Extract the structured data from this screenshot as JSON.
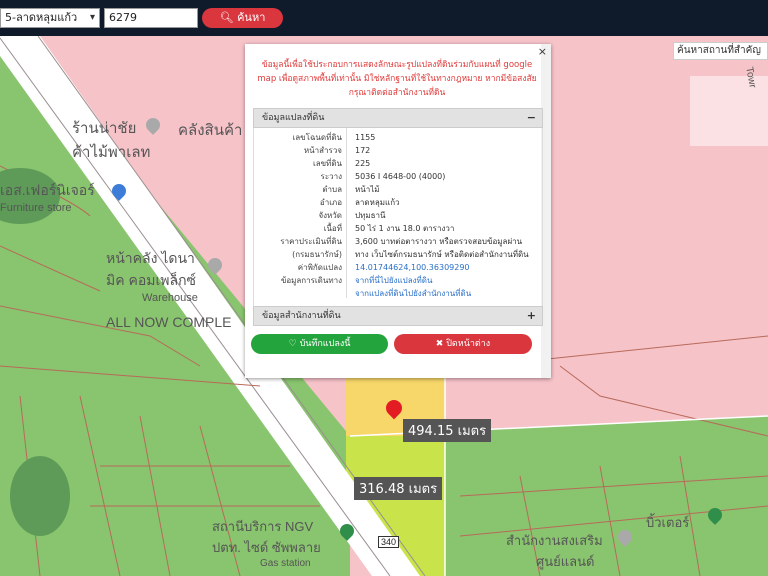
{
  "topbar": {
    "district_select": "5-ลาดหลุมแก้ว",
    "search_value": "6279",
    "search_button": "ค้นหา"
  },
  "map": {
    "search_place_placeholder": "ค้นหาสถานที่สำคัญ",
    "labels": {
      "shop_1_line1": "ร้านน่าชัย",
      "shop_1_line2": "ค้าไม้พาเลท",
      "shop_2": "คลังสินค้า",
      "furniture_line1": "เอส.เฟอร์นิเจอร์",
      "furniture_line2": "Furniture store",
      "warehouse_line1": "หน้าคลัง ไดนา",
      "warehouse_line2": "มิค คอมเพล็กซ์",
      "warehouse_line3": "Warehouse",
      "complex": "ALL NOW COMPLE",
      "gas_line1": "สถานีบริการ NGV",
      "gas_line2": "ปตท. ไซด์ ซัพพลาย",
      "gas_line3": "Gas station",
      "road_right": "Towr",
      "poi_right_1": "บิ้วเตอร์",
      "poi_right_2_line1": "สำนักงานสงเสริม",
      "poi_right_2_line2": "ศูนย์แลนด์",
      "road_number": "340"
    },
    "distance_1": "494.15 เมตร",
    "distance_2": "316.48 เมตร"
  },
  "popup": {
    "close": "×",
    "warning": "ข้อมูลนี้เพื่อใช้ประกอบการแสดงลักษณะรูปแปลงที่ดินร่วมกับแผนที่ google map เพื่อดูสภาพพื้นที่เท่านั้น มิใช่หลักฐานที่ใช้ในทางกฎหมาย หากมีข้อสงสัยกรุณาติดต่อสำนักงานที่ดิน",
    "section_1": "ข้อมูลแปลงที่ดิน",
    "section_1_toggle": "−",
    "rows": [
      {
        "k": "เลขโฉนดที่ดิน",
        "v": "1155"
      },
      {
        "k": "หน้าสำรวจ",
        "v": "172"
      },
      {
        "k": "เลขที่ดิน",
        "v": "225"
      },
      {
        "k": "ระวาง",
        "v": "5036 I 4648-00 (4000)"
      },
      {
        "k": "ตำบล",
        "v": "หน้าไม้"
      },
      {
        "k": "อำเภอ",
        "v": "ลาดหลุมแก้ว"
      },
      {
        "k": "จังหวัด",
        "v": "ปทุมธานี"
      },
      {
        "k": "เนื้อที่",
        "v": "50 ไร่ 1 งาน 18.0 ตารางวา"
      },
      {
        "k": "ราคาประเมินที่ดิน",
        "v": "3,600 บาทต่อตารางวา หรือตรวจสอบข้อมูลผ่าน"
      },
      {
        "k": "(กรมธนารักษ์)",
        "v": "ทาง เว็บไซต์กรมธนารักษ์ หรือติดต่อสำนักงานที่ดิน"
      },
      {
        "k": "ค่าพิกัดแปลง",
        "v": "14.01744624,100.36309290"
      },
      {
        "k": "ข้อมูลการเดินทาง",
        "v": "จากที่นี่ไปยังแปลงที่ดิน"
      },
      {
        "k": "",
        "v": "จากแปลงที่ดินไปยังสำนักงานที่ดิน"
      }
    ],
    "section_2": "ข้อมูลสำนักงานที่ดิน",
    "section_2_toggle": "+",
    "save_button": "บันทึกแปลงนี้",
    "close_button": "ปิดหน้าต่าง"
  }
}
